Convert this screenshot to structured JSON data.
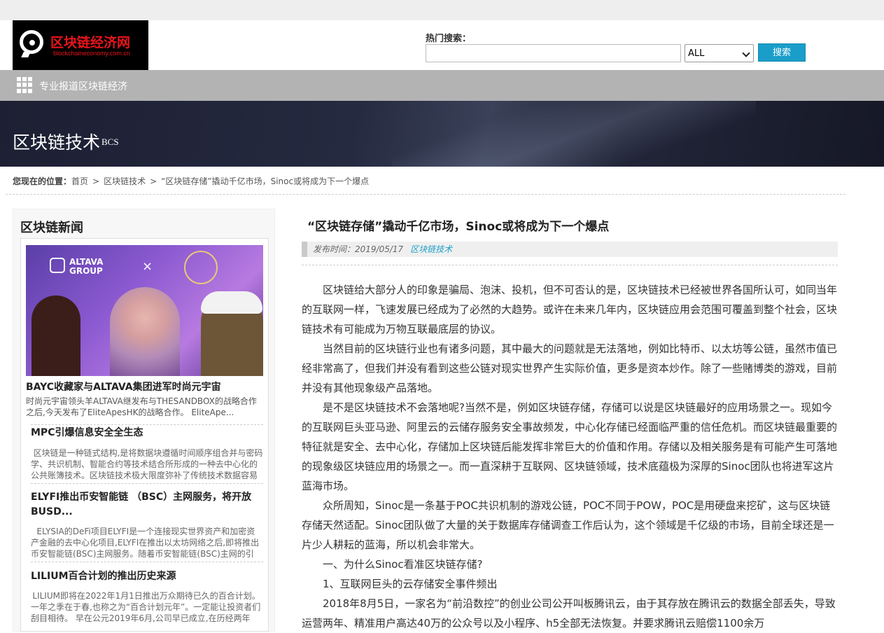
{
  "header": {
    "logo_title": "区块链经济网",
    "logo_sub": "blockchaineconomy.com.cn",
    "hot_search_label": "热门搜索：",
    "search_value": "",
    "select_value": "ALL",
    "search_button": "搜索"
  },
  "nav": {
    "text": "专业报道区块链经济"
  },
  "banner": {
    "title": "区块链技术",
    "sub": "BCS"
  },
  "breadcrumb": {
    "label": "您现在的位置：",
    "items": [
      "首页",
      "区块链技术",
      "“区块链存储”撬动千亿市场，Sinoc或将成为下一个爆点"
    ],
    "sep": ">"
  },
  "sidebar": {
    "title": "区块链新闻",
    "image": {
      "altava_line1": "ALTAVA",
      "altava_line2": "GROUP",
      "x": "×"
    },
    "news": [
      {
        "title": "BAYC收藏家与ALTAVA集团进军时尚元宇宙",
        "desc": "时尚元宇宙领头羊ALTAVA继发布与THESANDBOX的战略合作之后,今天发布了EliteApesHK的战略合作。 EliteApe..."
      },
      {
        "title": "MPC引爆信息安全全生态",
        "desc": "区块链是一种链式结构,是将数据块遵循时间顺序组合并与密码学、共识机制、智能合约等技术结合所形成的一种去中心化的公共账簿技术。区块链技术极大限度弥补了传统技术数据容易"
      },
      {
        "title": "ELYFI推出币安智能链 （BSC）主网服务，将开放BUSD...",
        "desc": "ELYSIA的DeFi项目ELYFI是一个连接现实世界资产和加密资产金融的去中心化项目,ELYFI在推出以太坊网络之后,即将推出币安智能链(BSC)主网服务。随着币安智能链(BSC)主网的引"
      },
      {
        "title": "LILIUM百合计划的推出历史来源",
        "desc": "LILIUM即将在2022年1月1日推出万众期待已久的百合计划。一年之季在于春,也称之为“百合计划元年”。一定能让投资者们刮目相待。 早在公元2019年6月,公司早已成立,在历经两年"
      }
    ]
  },
  "article": {
    "title": "“区块链存储”撬动千亿市场，Sinoc或将成为下一个爆点",
    "date": "发布时间：2019/05/17",
    "category": "区块链技术",
    "paragraphs": [
      "区块链给大部分人的印象是骗局、泡沫、投机，但不可否认的是，区块链技术已经被世界各国所认可，如同当年的互联网一样，飞速发展已经成为了必然的大趋势。或许在未来几年内，区块链应用会范围可覆盖到整个社会，区块链技术有可能成为万物互联最底层的协议。",
      "当然目前的区块链行业也有诸多问题，其中最大的问题就是无法落地，例如比特币、以太坊等公链，虽然市值已经非常高了，但我们并没有看到这些公链对现实世界产生实际价值，更多是资本炒作。除了一些赌博类的游戏，目前并没有其他现象级产品落地。",
      "是不是区块链技术不会落地呢?当然不是，例如区块链存储，存储可以说是区块链最好的应用场景之一。现如今的互联网巨头亚马逊、阿里云的云储存服务安全事故频发，中心化存储已经面临严重的信任危机。而区块链最重要的特征就是安全、去中心化，存储加上区块链后能发挥非常巨大的价值和作用。存储以及相关服务是有可能产生可落地的现象级区块链应用的场景之一。而一直深耕于互联网、区块链领域，技术底蕴极为深厚的Sinoc团队也将进军这片蓝海市场。",
      "众所周知，Sinoc是一条基于POC共识机制的游戏公链，POC不同于POW，POC是用硬盘来挖矿，这与区块链存储天然适配。Sinoc团队做了大量的关于数据库存储调查工作后认为，这个领域是千亿级的市场，目前全球还是一片少人耕耘的蓝海，所以机会非常大。",
      "一、为什么Sinoc看准区块链存储?",
      "1、互联网巨头的云存储安全事件频出",
      "2018年8月5日，一家名为“前沿数控”的创业公司公开叫板腾讯云，由于其存放在腾讯云的数据全部丢失，导致运营两年、精准用户高达40万的公众号以及小程序、h5全部无法恢复。并要求腾讯云赔偿1100余万"
    ]
  }
}
